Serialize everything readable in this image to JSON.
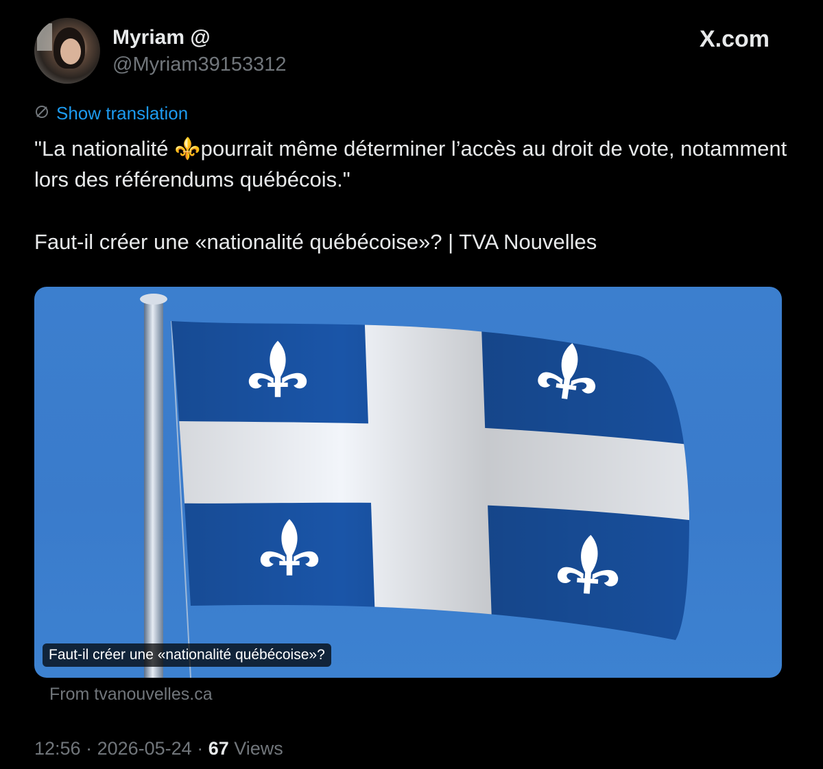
{
  "author": {
    "display_name": "Myriam @",
    "handle": "@Myriam39153312"
  },
  "brand": "X.com",
  "translation": {
    "icon": "translate-icon",
    "label": "Show translation"
  },
  "tweet": {
    "line1": "\"La nationalité ⚜️pourrait même déterminer l’accès au droit de vote, notamment lors des référendums québécois.\"",
    "line2": "Faut-il créer une «nationalité québécoise»? | TVA Nouvelles"
  },
  "card": {
    "image_subject": "quebec-flag-image",
    "caption": "Faut-il créer une «nationalité québécoise»?",
    "source": "From tvanouvelles.ca"
  },
  "meta": {
    "time": "12:56",
    "date": "2026-05-24",
    "separator": " · ",
    "views_count": "67",
    "views_label": "Views"
  },
  "colors": {
    "background": "#000000",
    "text": "#e7e9ea",
    "muted": "#71767b",
    "link": "#1d9bf0",
    "flag_blue": "#1a55a8",
    "sky": "#3a7bcb"
  }
}
